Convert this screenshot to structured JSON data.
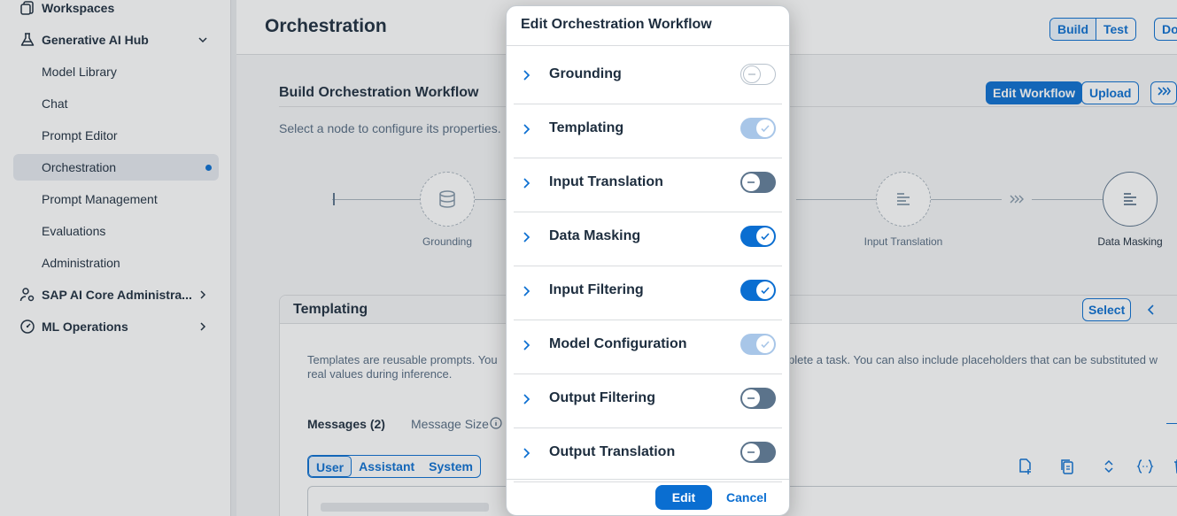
{
  "sidebar": {
    "items": [
      {
        "label": "Workspaces",
        "icon": "workspaces-icon",
        "level": "top"
      },
      {
        "label": "Generative AI Hub",
        "icon": "flask-icon",
        "level": "top",
        "expanded": true
      },
      {
        "label": "Model Library",
        "level": "sub"
      },
      {
        "label": "Chat",
        "level": "sub"
      },
      {
        "label": "Prompt Editor",
        "level": "sub"
      },
      {
        "label": "Orchestration",
        "level": "sub",
        "active": true
      },
      {
        "label": "Prompt Management",
        "level": "sub"
      },
      {
        "label": "Evaluations",
        "level": "sub"
      },
      {
        "label": "Administration",
        "level": "sub"
      },
      {
        "label": "SAP AI Core Administra...",
        "icon": "user-settings-icon",
        "level": "top"
      },
      {
        "label": "ML Operations",
        "icon": "dashboard-icon",
        "level": "top"
      }
    ]
  },
  "header": {
    "title": "Orchestration",
    "build_label": "Build",
    "test_label": "Test",
    "doc_label": "Do"
  },
  "workflow": {
    "title": "Build Orchestration Workflow",
    "hint": "Select a node to configure its properties.",
    "edit_workflow_label": "Edit Workflow",
    "upload_label": "Upload",
    "nodes": [
      {
        "label": "Grounding"
      },
      {
        "label": "Input Translation"
      },
      {
        "label": "Data Masking"
      }
    ]
  },
  "templating": {
    "title": "Templating",
    "select_label": "Select",
    "description_line1": "Templates are reusable prompts. You",
    "description_line1_right": "plete a task. You can also include placeholders that can be substituted w",
    "description_line2": "real values during inference.",
    "messages_label": "Messages (2)",
    "message_size_label": "Message Size",
    "roles": [
      "User",
      "Assistant",
      "System"
    ]
  },
  "dialog": {
    "title": "Edit Orchestration Workflow",
    "rows": [
      {
        "label": "Grounding",
        "state": "off-disabled"
      },
      {
        "label": "Templating",
        "state": "on-disabled"
      },
      {
        "label": "Input Translation",
        "state": "off"
      },
      {
        "label": "Data Masking",
        "state": "on"
      },
      {
        "label": "Input Filtering",
        "state": "on"
      },
      {
        "label": "Model Configuration",
        "state": "on-disabled"
      },
      {
        "label": "Output Filtering",
        "state": "off"
      },
      {
        "label": "Output Translation",
        "state": "off"
      }
    ],
    "edit_label": "Edit",
    "cancel_label": "Cancel"
  },
  "colors": {
    "accent": "#0a6ed1",
    "toggle_off": "#5b738b",
    "toggle_on_disabled": "#a8c6e8"
  }
}
